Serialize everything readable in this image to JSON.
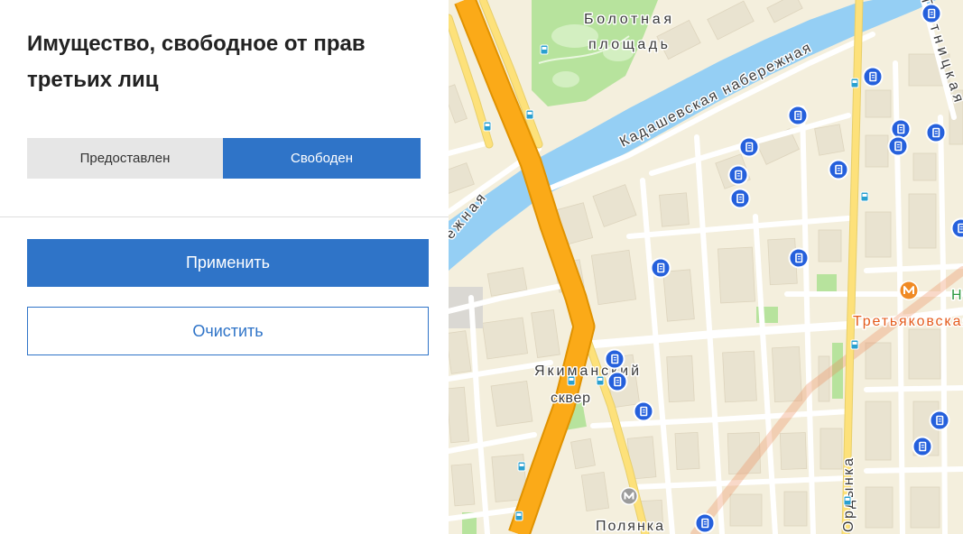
{
  "filter_panel": {
    "title": "Имущество, свободное от прав третьих лиц",
    "toggle": {
      "options": [
        {
          "label": "Предоставлен",
          "selected": false
        },
        {
          "label": "Свободен",
          "selected": true
        }
      ]
    },
    "apply_label": "Применить",
    "clear_label": "Очистить"
  },
  "map": {
    "labels": {
      "bolotnaya_line1": "Болотная",
      "bolotnaya_line2": "площадь",
      "kadashevskaya": "Кадашевская набережная",
      "sofiyskaya_fragment": "ежная",
      "pyatnitskaya": "Пятницкая",
      "yakimanskiy_line1": "Якиманский",
      "yakimanskiy_line2": "сквер",
      "polyanka": "Полянка",
      "tretyakovskaya": "Третьяковская",
      "novokuznetskaya_fragment": "Н",
      "ordynka": "Ордынка"
    },
    "icons": {
      "property_marker": "document-pin-icon",
      "metro": "metro-icon",
      "bus_stop": "bus-stop-icon"
    }
  },
  "colors": {
    "accent": "#2f74c8",
    "toggle_inactive_bg": "#e6e6e6",
    "title_text": "#222222",
    "map_land": "#f4efdd",
    "map_water": "#95cff4",
    "map_park": "#b7e39d",
    "map_major_road": "#fbaa18",
    "map_secondary_road": "#fde17a",
    "property_marker": "#2560dc",
    "metro_tretyakovskaya": "#f08a24",
    "metro_polyanka": "#9b9b9b",
    "bus_stop": "#2aa0d0",
    "label_tretyakovskaya": "#e45b1c",
    "label_novokuznetskaya": "#2e9a40"
  }
}
